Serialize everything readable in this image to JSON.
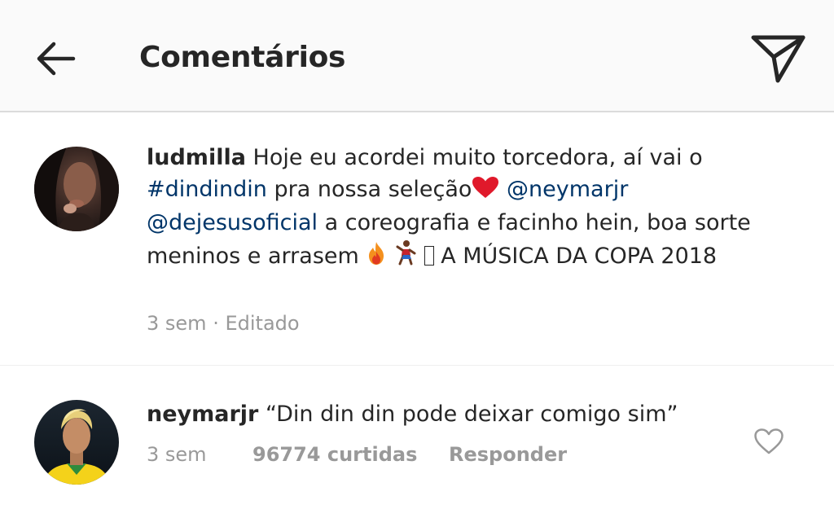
{
  "header": {
    "title": "Comentários",
    "back_icon": "arrow-left-icon",
    "share_icon": "paper-plane-icon"
  },
  "caption": {
    "username": "ludmilla",
    "text_1": "Hoje eu acordei muito torcedora, aí vai o",
    "hashtag": "#dindindin",
    "text_2": "pra nossa seleção",
    "mention_1": "@neymarjr",
    "mention_2": "@dejesusoficial",
    "text_3": "a coreografia e facinho hein, boa sorte meninos e arrasem",
    "text_4": "A MÚSICA DA COPA 2018",
    "time": "3 sem",
    "separator": "·",
    "edited": "Editado"
  },
  "comment": {
    "username": "neymarjr",
    "text": "“Din din din pode deixar comigo sim”",
    "time": "3 sem",
    "likes": "96774 curtidas",
    "reply": "Responder",
    "like_icon": "heart-icon"
  },
  "colors": {
    "link": "#003569",
    "meta": "#999999",
    "text": "#262626",
    "header_bg": "#fafafa"
  }
}
